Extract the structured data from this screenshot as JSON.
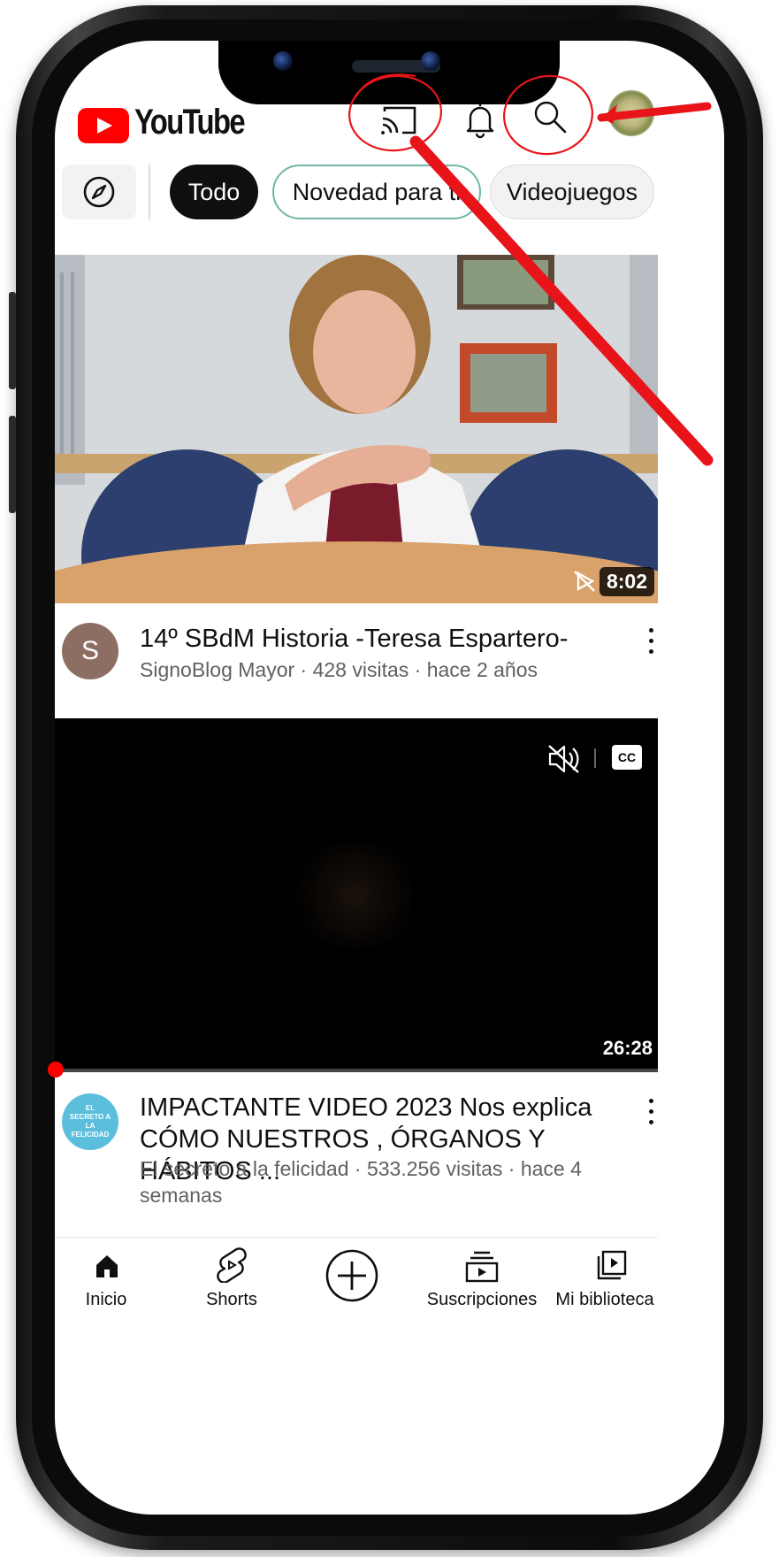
{
  "header": {
    "logo_text": "YouTube"
  },
  "chips": {
    "all": "Todo",
    "new_for_you": "Novedad para ti",
    "games": "Videojuegos"
  },
  "videos": [
    {
      "title": "14º SBdM Historia -Teresa Espartero-",
      "channel_meta": "SignoBlog Mayor · 428 visitas · hace 2 años",
      "duration": "8:02",
      "avatar_letter": "S"
    },
    {
      "title": "IMPACTANTE VIDEO 2023 Nos explica CÓMO NUESTROS , ÓRGANOS Y HÁBITOS ...",
      "channel_meta": "El secreto a la felicidad · 533.256 visitas · hace 4 semanas",
      "duration": "26:28",
      "avatar_text": "EL SECRETO A LA FELICIDAD"
    }
  ],
  "player": {
    "cc_label": "CC"
  },
  "bottom_nav": {
    "home": "Inicio",
    "shorts": "Shorts",
    "subscriptions": "Suscripciones",
    "library": "Mi biblioteca"
  },
  "colors": {
    "brand_red": "#ff0000",
    "annotation_red": "#e8141a",
    "avatar_brown": "#8d6e63",
    "avatar_teal": "#5bbfdc"
  }
}
